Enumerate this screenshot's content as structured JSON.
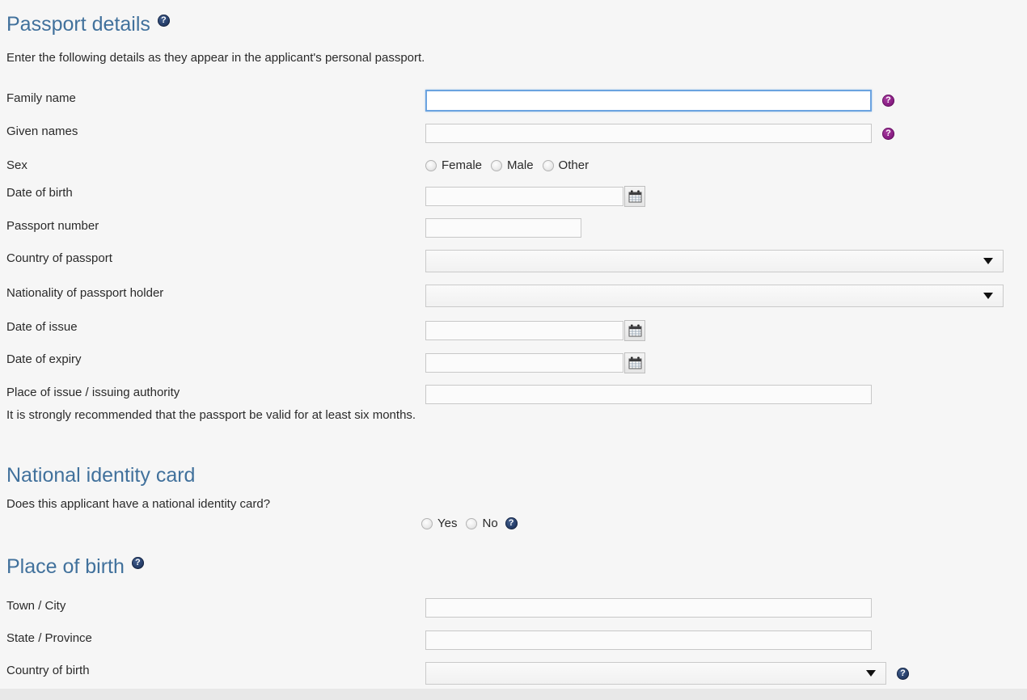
{
  "passport_section": {
    "heading": "Passport details",
    "heading_help_icon": "help-icon",
    "intro": "Enter the following details as they appear in the applicant's personal passport.",
    "fields": [
      {
        "label": "Family name",
        "type": "text",
        "value": "",
        "focused": true,
        "help_icon": "help-icon-purple"
      },
      {
        "label": "Given names",
        "type": "text",
        "value": "",
        "focused": false,
        "help_icon": "help-icon-purple"
      },
      {
        "label": "Sex",
        "type": "radio",
        "options": [
          "Female",
          "Male",
          "Other"
        ],
        "selected": ""
      },
      {
        "label": "Date of birth",
        "type": "date",
        "value": "",
        "calendar_icon": "calendar-icon"
      },
      {
        "label": "Passport number",
        "type": "text",
        "value": ""
      },
      {
        "label": "Country of passport",
        "type": "select",
        "value": ""
      },
      {
        "label": "Nationality of passport holder",
        "type": "select",
        "value": ""
      },
      {
        "label": "Date of issue",
        "type": "date",
        "value": "",
        "calendar_icon": "calendar-icon"
      },
      {
        "label": "Date of expiry",
        "type": "date",
        "value": "",
        "calendar_icon": "calendar-icon"
      },
      {
        "label": "Place of issue / issuing authority",
        "type": "text",
        "value": ""
      }
    ],
    "note": "It is strongly recommended that the passport be valid for at least six months."
  },
  "national_id_section": {
    "heading": "National identity card",
    "question": "Does this applicant have a national identity card?",
    "options": [
      "Yes",
      "No"
    ],
    "selected": "",
    "help_icon": "help-icon-blue"
  },
  "place_of_birth_section": {
    "heading": "Place of birth",
    "heading_help_icon": "help-icon-blue",
    "fields": [
      {
        "label": "Town / City",
        "type": "text",
        "value": ""
      },
      {
        "label": "State / Province",
        "type": "text",
        "value": ""
      },
      {
        "label": "Country of birth",
        "type": "select",
        "value": "",
        "help_icon": "help-icon-blue"
      }
    ]
  },
  "colors": {
    "heading_blue": "#41719c",
    "help_purple": "#8b1f86",
    "help_blue": "#27406c",
    "page_background": "#f6f6f6",
    "focus_border": "#6ba3e0",
    "field_border": "#c8c8c8",
    "text": "#2a2a2a"
  }
}
